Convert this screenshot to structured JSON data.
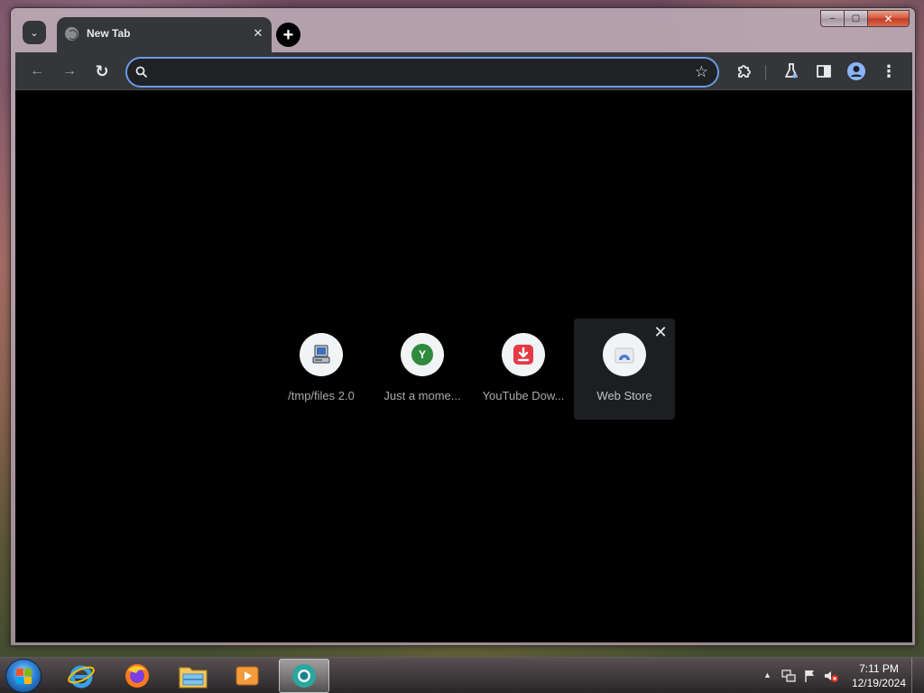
{
  "window": {
    "controls": {
      "minimize": "‒",
      "maximize": "▢",
      "close": "✕"
    }
  },
  "tabstrip": {
    "tab_search_glyph": "⌄",
    "active_tab": {
      "title": "New Tab",
      "favicon": "globe-icon",
      "close_glyph": "✕"
    },
    "new_tab_glyph": "+"
  },
  "toolbar": {
    "back_glyph": "←",
    "forward_glyph": "→",
    "reload_glyph": "↻",
    "omnibox": {
      "value": "",
      "placeholder": ""
    },
    "bookmark_glyph": "☆",
    "extensions_icon": "puzzle-icon",
    "labs_icon": "flask-icon",
    "side_panel_icon": "side-panel-icon",
    "profile_icon": "profile-icon",
    "menu_glyph": "⋮"
  },
  "shortcuts": [
    {
      "label": "/tmp/files 2.0",
      "icon": "computer-icon"
    },
    {
      "label": "Just a mome...",
      "icon": "y-letter-icon",
      "letter": "Y"
    },
    {
      "label": "YouTube Dow...",
      "icon": "download-icon"
    },
    {
      "label": "Web Store",
      "icon": "web-store-icon",
      "remove_glyph": "✕"
    }
  ],
  "taskbar": {
    "apps": [
      "internet-explorer-icon",
      "firefox-icon",
      "file-explorer-icon",
      "media-player-icon",
      "chrome-icon"
    ],
    "tray": {
      "overflow_glyph": "▲",
      "time": "7:11 PM",
      "date": "12/19/2024"
    }
  },
  "colors": {
    "omnibox_focus": "#6a9be8",
    "toolbar_bg": "#35363a",
    "content_bg": "#000000",
    "download_red": "#e53946",
    "y_green": "#2f8a3e"
  }
}
